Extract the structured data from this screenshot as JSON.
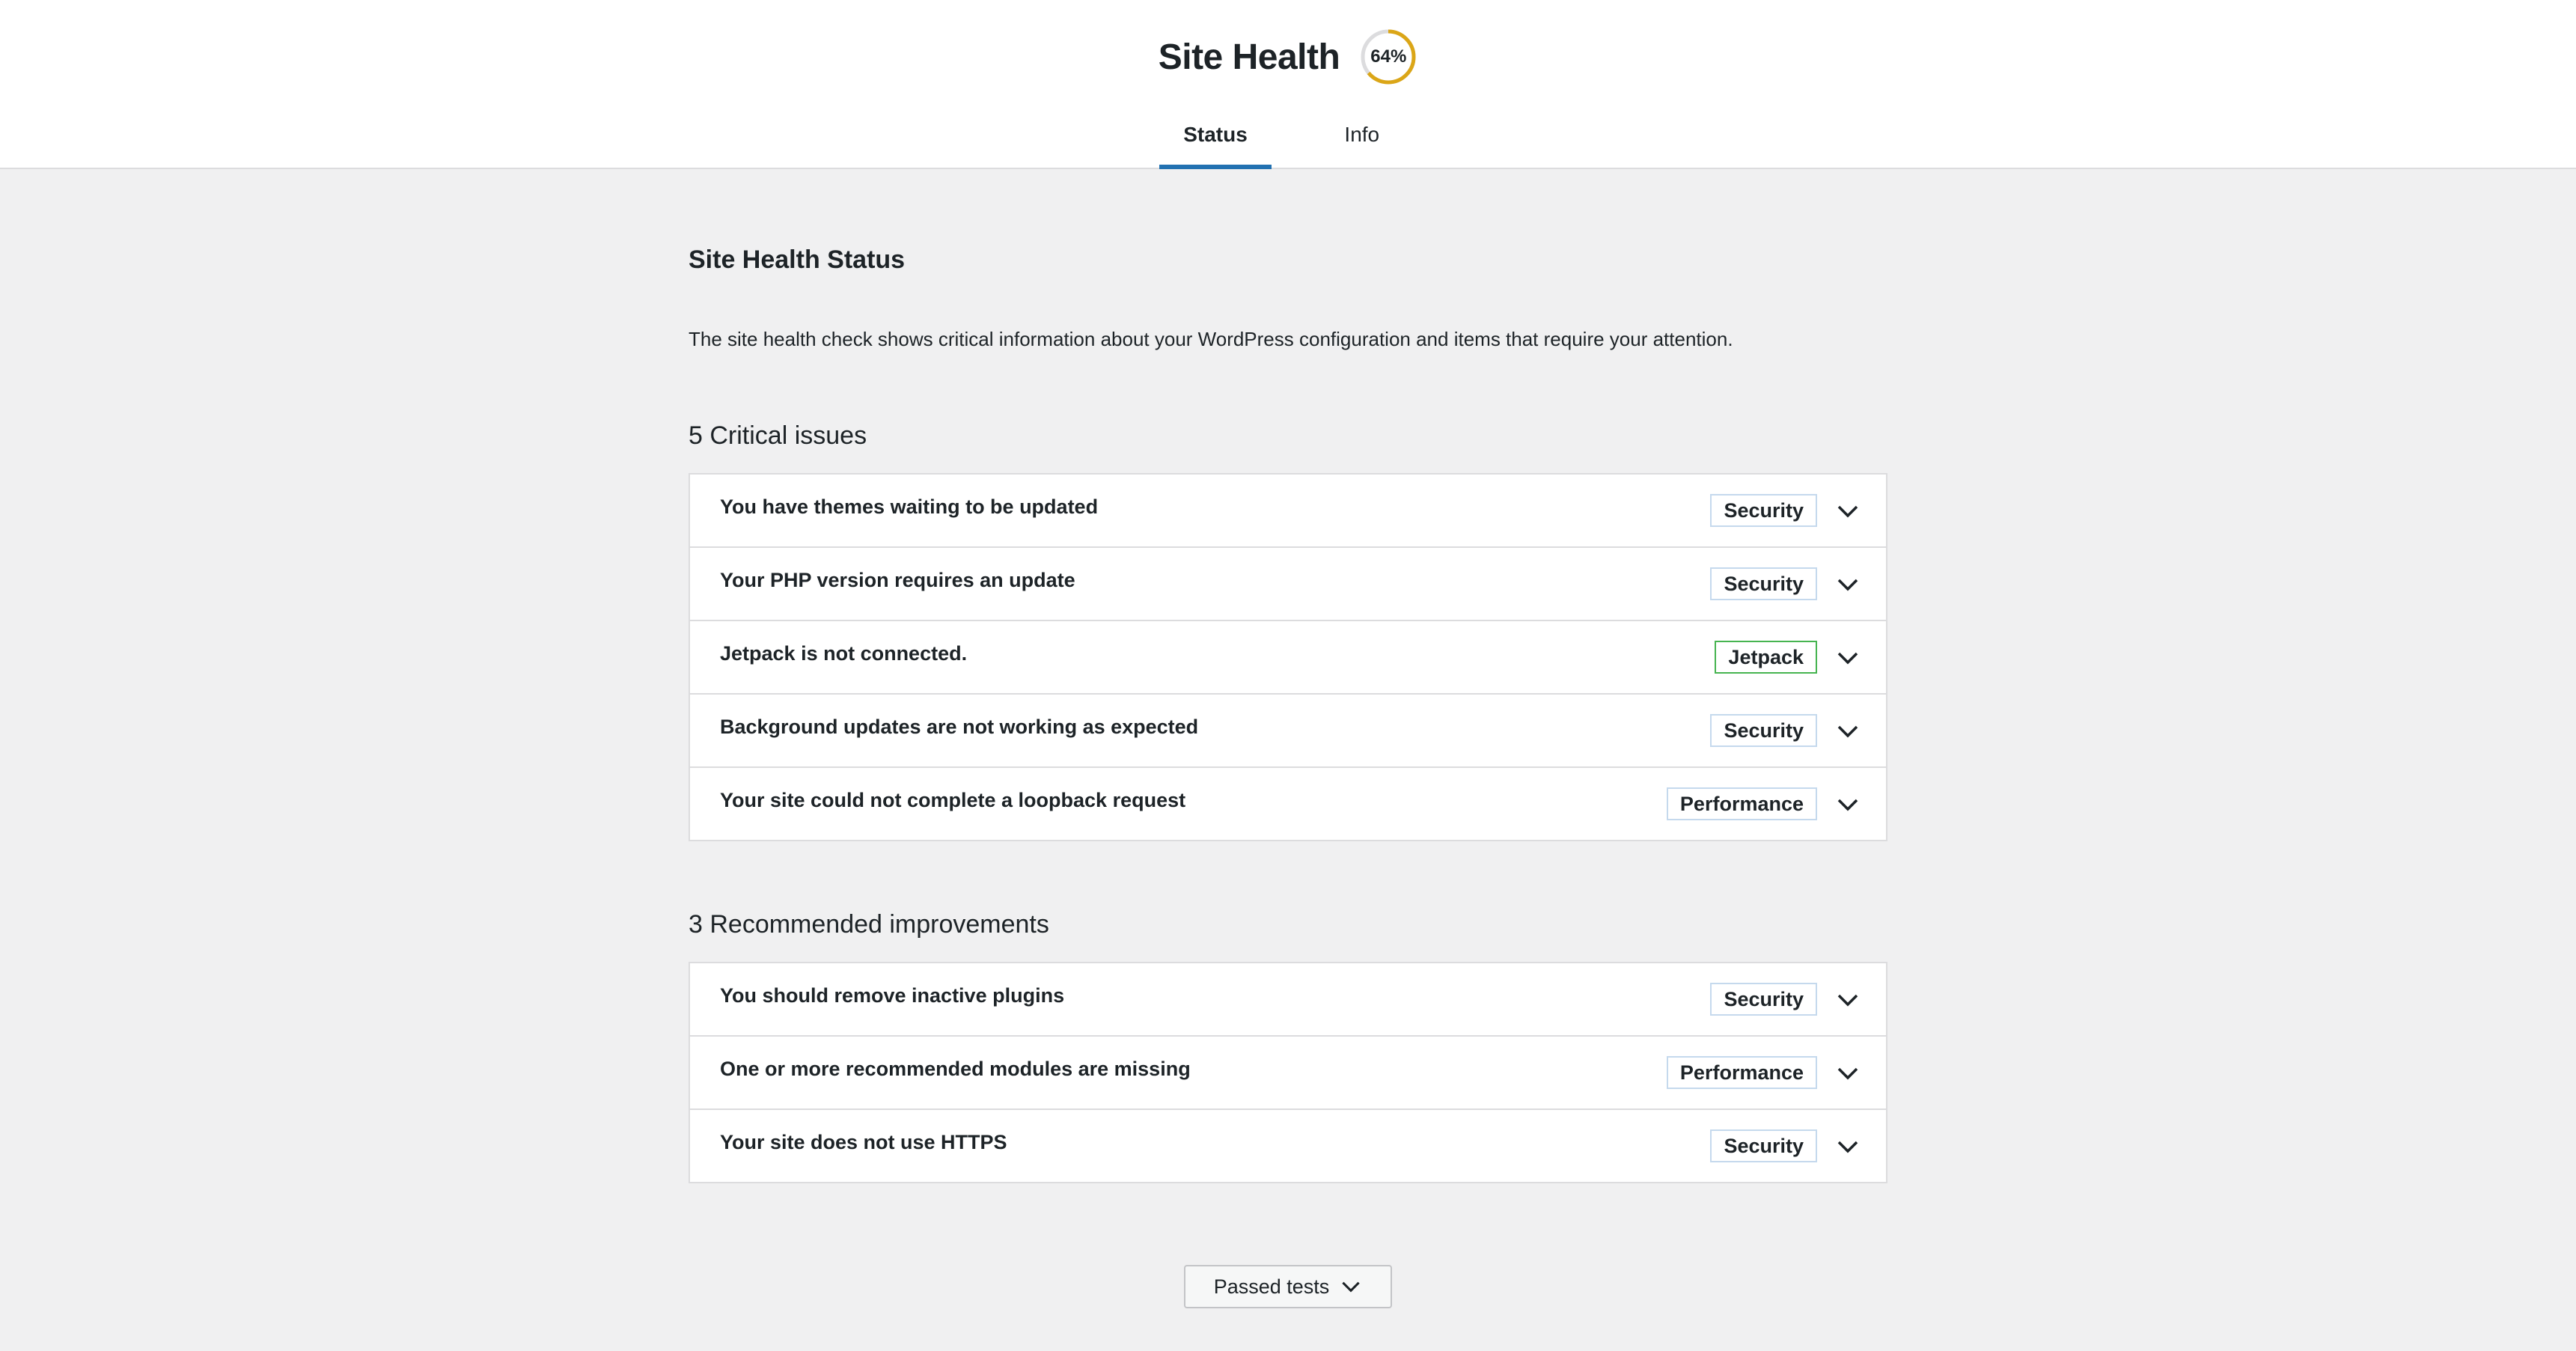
{
  "header": {
    "title": "Site Health",
    "score_label": "64%",
    "score": 0.64,
    "score_color": "#dba617",
    "track_color": "#dcdcde",
    "tabs": [
      {
        "label": "Status",
        "active": true
      },
      {
        "label": "Info",
        "active": false
      }
    ],
    "active_tab_color": "#2271b1"
  },
  "main": {
    "title": "Site Health Status",
    "description": "The site health check shows critical information about your WordPress configuration and items that require your attention.",
    "critical": {
      "title": "5 Critical issues",
      "items": [
        {
          "label": "You have themes waiting to be updated",
          "badge": "Security",
          "badge_color": "#c5d9ed",
          "icon": "chevron-down-icon"
        },
        {
          "label": "Your PHP version requires an update",
          "badge": "Security",
          "badge_color": "#c5d9ed",
          "icon": "chevron-down-icon"
        },
        {
          "label": "Jetpack is not connected.",
          "badge": "Jetpack",
          "badge_color": "#46b450",
          "icon": "chevron-down-icon"
        },
        {
          "label": "Background updates are not working as expected",
          "badge": "Security",
          "badge_color": "#c5d9ed",
          "icon": "chevron-down-icon"
        },
        {
          "label": "Your site could not complete a loopback request",
          "badge": "Performance",
          "badge_color": "#c5d9ed",
          "icon": "chevron-down-icon"
        }
      ]
    },
    "recommended": {
      "title": "3 Recommended improvements",
      "items": [
        {
          "label": "You should remove inactive plugins",
          "badge": "Security",
          "badge_color": "#c5d9ed",
          "icon": "chevron-down-icon"
        },
        {
          "label": "One or more recommended modules are missing",
          "badge": "Performance",
          "badge_color": "#c5d9ed",
          "icon": "chevron-down-icon"
        },
        {
          "label": "Your site does not use HTTPS",
          "badge": "Security",
          "badge_color": "#c5d9ed",
          "icon": "chevron-down-icon"
        }
      ]
    },
    "passed_tests_label": "Passed tests"
  }
}
